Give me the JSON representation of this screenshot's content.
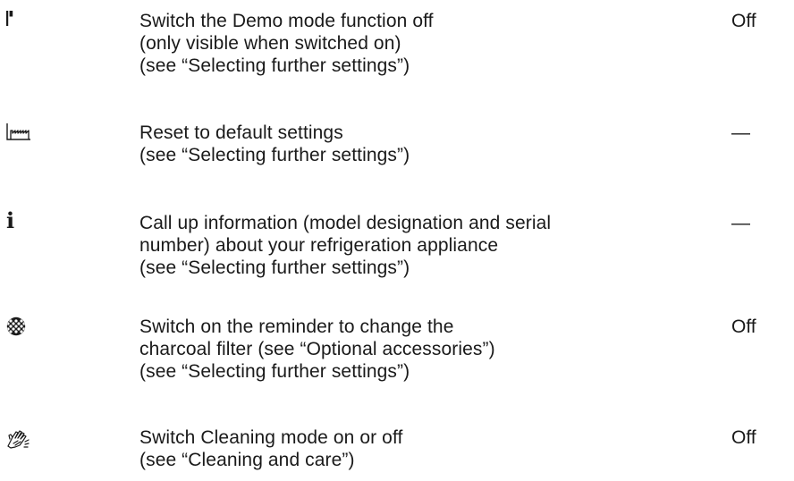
{
  "rows": [
    {
      "icon": "demo-mode-flag-icon",
      "lines": [
        "Switch the Demo mode function off",
        "(only visible when switched on)",
        "(see “Selecting further settings”)"
      ],
      "default": "Off"
    },
    {
      "icon": "factory-reset-icon",
      "lines": [
        "Reset to default settings",
        "(see “Selecting further settings”)"
      ],
      "default": "—"
    },
    {
      "icon": "info-icon",
      "icon_glyph": "i",
      "lines": [
        "Call up information (model designation and serial",
        "number) about your refrigeration appliance",
        "(see “Selecting further settings”)"
      ],
      "default": "—"
    },
    {
      "icon": "charcoal-filter-icon",
      "lines": [
        "Switch on the reminder to change the",
        "charcoal filter (see “Optional accessories”)",
        "(see “Selecting further settings”)"
      ],
      "default": "Off"
    },
    {
      "icon": "cleaning-hand-icon",
      "lines": [
        "Switch Cleaning mode on or off",
        "(see “Cleaning and care”)"
      ],
      "default": "Off"
    }
  ]
}
